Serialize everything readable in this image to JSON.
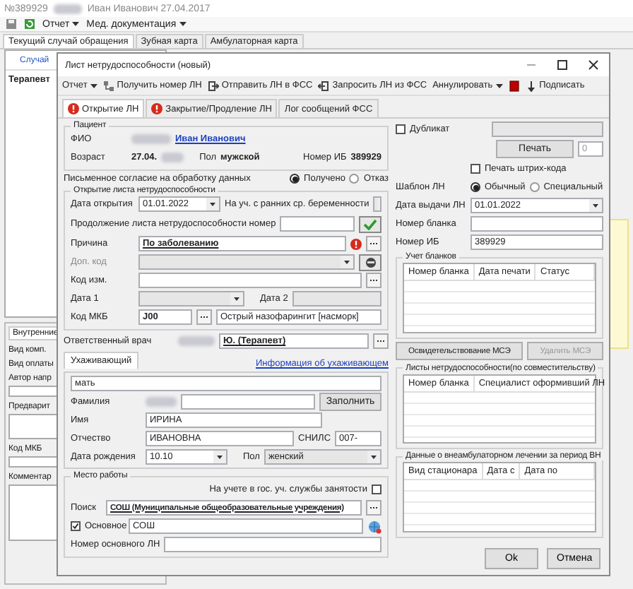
{
  "app": {
    "record_number": "№389929",
    "patient": "Иван Иванович 27.04.2017",
    "menus": [
      "Отчет",
      "Мед. документация"
    ],
    "tabs": [
      {
        "label": "Текущий случай обращения",
        "selected": true
      },
      {
        "label": "Зубная карта",
        "selected": false
      },
      {
        "label": "Амбулаторная карта",
        "selected": false
      }
    ],
    "tree_header": "Случай",
    "tree_item": "Терапевт",
    "lower_tab": "Внутренние",
    "lower_labels": [
      "Вид комп.",
      "Вид оплаты",
      "Автор напр",
      "Предварит",
      "Код МКБ",
      "Комментар"
    ]
  },
  "dialog": {
    "title": "Лист нетрудоспособности (новый)",
    "toolbar": [
      {
        "kind": "menu",
        "label": "Отчет"
      },
      {
        "kind": "get",
        "label": "Получить номер ЛН"
      },
      {
        "kind": "send",
        "label": "Отправить ЛН в ФСС"
      },
      {
        "kind": "request",
        "label": "Запросить ЛН из ФСС"
      },
      {
        "kind": "menu",
        "label": "Аннулировать"
      },
      {
        "kind": "stop"
      },
      {
        "kind": "sign",
        "label": "Подписать"
      }
    ],
    "tabs": [
      {
        "label": "Открытие ЛН",
        "selected": true,
        "alert": true
      },
      {
        "label": "Закрытие/Продление ЛН",
        "selected": false,
        "alert": true
      },
      {
        "label": "Лог сообщений ФСС",
        "selected": false,
        "alert": false
      }
    ],
    "patient": {
      "group": "Пациент",
      "fio_label": "ФИО",
      "name": "Иван Иванович",
      "age_label": "Возраст",
      "age": "27.04.",
      "sex_label": "Пол",
      "sex": "мужской",
      "ib_label": "Номер ИБ",
      "ib": "389929"
    },
    "consent": {
      "label": "Письменное согласие на обработку данных",
      "options": [
        {
          "label": "Получено",
          "selected": true
        },
        {
          "label": "Отказ",
          "selected": false
        }
      ]
    },
    "opening": {
      "group": "Открытие листа нетрудоспособности",
      "open_date_label": "Дата открытия",
      "open_date": "01.01.2022",
      "pregnancy_label": "На уч. с ранних ср. беременности",
      "continuation_label": "Продолжение листа нетрудоспособности номер",
      "reason_label": "Причина",
      "reason": "По заболеванию",
      "reason_error": true,
      "extra_code_label": "Доп. код",
      "change_code_label": "Код изм.",
      "date1_label": "Дата 1",
      "date2_label": "Дата 2",
      "icd_label": "Код МКБ",
      "icd": "J00",
      "diagnosis": "Острый назофарингит [насморк]"
    },
    "doctor": {
      "label": "Ответственный врач",
      "value": "Ю. (Терапевт)"
    },
    "caretaker": {
      "tab": "Ухаживающий",
      "info_link": "Информация об ухаживающем",
      "relation": "мать",
      "surname_label": "Фамилия",
      "fill_button": "Заполнить",
      "name_label": "Имя",
      "name": "ИРИНА",
      "patronymic_label": "Отчество",
      "patronymic": "ИВАНОВНА",
      "snils_label": "СНИЛС",
      "snils": "007-",
      "birth_label": "Дата рождения",
      "birth": "10.10",
      "sex_label": "Пол",
      "sex": "женский"
    },
    "work": {
      "group": "Место работы",
      "employment_label": "На учете в гос. уч. службы занятости",
      "employment_checked": false,
      "search_label": "Поиск",
      "search": "СОШ (Муниципальные общеобразовательные учреждения)",
      "main_label": "Основное",
      "main_checked": true,
      "main_value": "СОШ",
      "main_number_label": "Номер основного ЛН"
    },
    "side": {
      "duplicate_label": "Дубликат",
      "duplicate_checked": false,
      "print_button": "Печать",
      "print_copies": "0",
      "barcode_label": "Печать штрих-кода",
      "barcode_checked": false,
      "template_label": "Шаблон ЛН",
      "template_options": [
        {
          "label": "Обычный",
          "selected": true
        },
        {
          "label": "Специальный",
          "selected": false
        }
      ],
      "issue_date_label": "Дата выдачи ЛН",
      "issue_date": "01.01.2022",
      "blank_label": "Номер бланка",
      "ib_label": "Номер ИБ",
      "ib": "389929"
    },
    "blanks": {
      "group": "Учет бланков",
      "columns": [
        "Номер бланка",
        "Дата печати",
        "Статус"
      ]
    },
    "mse_buttons": [
      {
        "label": "Освидетельствование МСЭ",
        "disabled": false
      },
      {
        "label": "Удалить МСЭ",
        "disabled": true
      }
    ],
    "part_time": {
      "group": "Листы нетрудоспособности(по совместительству)",
      "columns": [
        "Номер бланка",
        "Специалист оформивший ЛН"
      ]
    },
    "inpatient": {
      "group": "Данные о внеамбулаторном лечении за период ВН",
      "columns": [
        "Вид стационара",
        "Дата с",
        "Дата по"
      ]
    },
    "buttons": [
      "Ok",
      "Отмена"
    ]
  }
}
